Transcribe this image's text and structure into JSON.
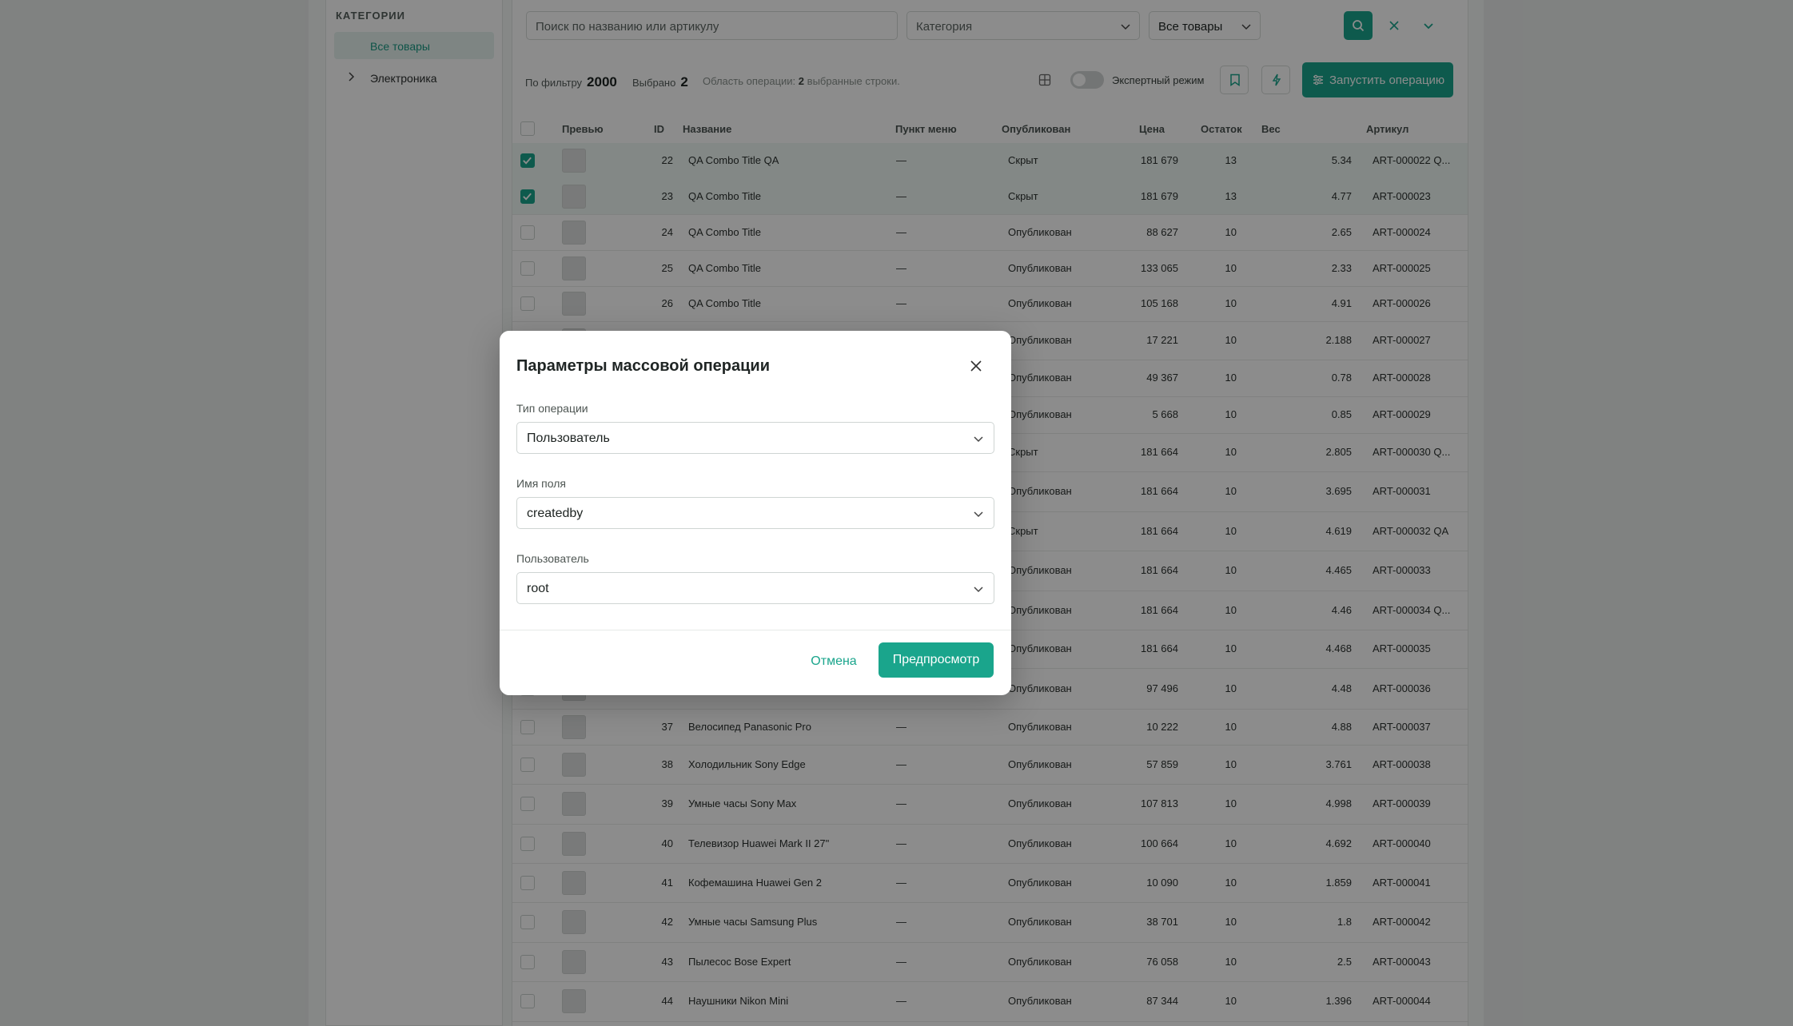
{
  "sidebar": {
    "title": "КАТЕГОРИИ",
    "items": [
      {
        "label": "Все товары"
      },
      {
        "label": "Электроника"
      }
    ]
  },
  "search": {
    "placeholder": "Поиск по названию или артикулу"
  },
  "filters": {
    "category": "Категория",
    "scope": "Все товары"
  },
  "stats": {
    "filter_label": "По фильтру",
    "filter_count": "2000",
    "selected_label": "Выбрано",
    "selected_count": "2",
    "scope_label": "Область операции:",
    "scope_count": "2",
    "scope_text": "выбранные строки."
  },
  "toolbar": {
    "expert_mode": "Экспертный режим",
    "run": "Запустить операцию"
  },
  "table": {
    "headers": {
      "preview": "Превью",
      "id": "ID",
      "name": "Название",
      "menu": "Пункт меню",
      "published": "Опубликован",
      "price": "Цена",
      "stock": "Остаток",
      "weight": "Вес",
      "sku": "Артикул"
    },
    "rows": [
      {
        "id": "22",
        "name": "QA Combo Title QA",
        "menu": "—",
        "status": "Скрыт",
        "price": "181 679",
        "stock": "13",
        "weight": "5.34",
        "sku": "ART-000022 Q...",
        "selected": true
      },
      {
        "id": "23",
        "name": "QA Combo Title",
        "menu": "—",
        "status": "Скрыт",
        "price": "181 679",
        "stock": "13",
        "weight": "4.77",
        "sku": "ART-000023",
        "selected": true
      },
      {
        "id": "24",
        "name": "QA Combo Title",
        "menu": "—",
        "status": "Опубликован",
        "price": "88 627",
        "stock": "10",
        "weight": "2.65",
        "sku": "ART-000024",
        "selected": false
      },
      {
        "id": "25",
        "name": "QA Combo Title",
        "menu": "—",
        "status": "Опубликован",
        "price": "133 065",
        "stock": "10",
        "weight": "2.33",
        "sku": "ART-000025",
        "selected": false
      },
      {
        "id": "26",
        "name": "QA Combo Title",
        "menu": "—",
        "status": "Опубликован",
        "price": "105 168",
        "stock": "10",
        "weight": "4.91",
        "sku": "ART-000026",
        "selected": false
      },
      {
        "id": "",
        "name": "",
        "menu": "",
        "status": "Опубликован",
        "price": "17 221",
        "stock": "10",
        "weight": "2.188",
        "sku": "ART-000027",
        "selected": false
      },
      {
        "id": "",
        "name": "",
        "menu": "",
        "status": "Опубликован",
        "price": "49 367",
        "stock": "10",
        "weight": "0.78",
        "sku": "ART-000028",
        "selected": false
      },
      {
        "id": "",
        "name": "",
        "menu": "",
        "status": "Опубликован",
        "price": "5 668",
        "stock": "10",
        "weight": "0.85",
        "sku": "ART-000029",
        "selected": false
      },
      {
        "id": "",
        "name": "",
        "menu": "",
        "status": "Скрыт",
        "price": "181 664",
        "stock": "10",
        "weight": "2.805",
        "sku": "ART-000030 Q...",
        "selected": false
      },
      {
        "id": "",
        "name": "",
        "menu": "",
        "status": "Опубликован",
        "price": "181 664",
        "stock": "10",
        "weight": "3.695",
        "sku": "ART-000031",
        "selected": false
      },
      {
        "id": "",
        "name": "",
        "menu": "",
        "status": "Скрыт",
        "price": "181 664",
        "stock": "10",
        "weight": "4.619",
        "sku": "ART-000032 QA",
        "selected": false
      },
      {
        "id": "",
        "name": "",
        "menu": "",
        "status": "Опубликован",
        "price": "181 664",
        "stock": "10",
        "weight": "4.465",
        "sku": "ART-000033",
        "selected": false
      },
      {
        "id": "",
        "name": "",
        "menu": "",
        "status": "Опубликован",
        "price": "181 664",
        "stock": "10",
        "weight": "4.46",
        "sku": "ART-000034 Q...",
        "selected": false
      },
      {
        "id": "",
        "name": "",
        "menu": "",
        "status": "Опубликован",
        "price": "181 664",
        "stock": "10",
        "weight": "4.468",
        "sku": "ART-000035",
        "selected": false
      },
      {
        "id": "",
        "name": "",
        "menu": "",
        "status": "Опубликован",
        "price": "97 496",
        "stock": "10",
        "weight": "4.48",
        "sku": "ART-000036",
        "selected": false
      },
      {
        "id": "37",
        "name": "Велосипед Panasonic Pro",
        "menu": "—",
        "status": "Опубликован",
        "price": "10 222",
        "stock": "10",
        "weight": "4.88",
        "sku": "ART-000037",
        "selected": false
      },
      {
        "id": "38",
        "name": "Холодильник Sony Edge",
        "menu": "—",
        "status": "Опубликован",
        "price": "57 859",
        "stock": "10",
        "weight": "3.761",
        "sku": "ART-000038",
        "selected": false
      },
      {
        "id": "39",
        "name": "Умные часы Sony Max",
        "menu": "—",
        "status": "Опубликован",
        "price": "107 813",
        "stock": "10",
        "weight": "4.998",
        "sku": "ART-000039",
        "selected": false
      },
      {
        "id": "40",
        "name": "Телевизор Huawei Mark II 27\"",
        "menu": "—",
        "status": "Опубликован",
        "price": "100 664",
        "stock": "10",
        "weight": "4.692",
        "sku": "ART-000040",
        "selected": false
      },
      {
        "id": "41",
        "name": "Кофемашина Huawei Gen 2",
        "menu": "—",
        "status": "Опубликован",
        "price": "10 090",
        "stock": "10",
        "weight": "1.859",
        "sku": "ART-000041",
        "selected": false
      },
      {
        "id": "42",
        "name": "Умные часы Samsung Plus",
        "menu": "—",
        "status": "Опубликован",
        "price": "38 701",
        "stock": "10",
        "weight": "1.8",
        "sku": "ART-000042",
        "selected": false
      },
      {
        "id": "43",
        "name": "Пылесос Bose Expert",
        "menu": "—",
        "status": "Опубликован",
        "price": "76 058",
        "stock": "10",
        "weight": "2.5",
        "sku": "ART-000043",
        "selected": false
      },
      {
        "id": "44",
        "name": "Наушники Nikon Mini",
        "menu": "—",
        "status": "Опубликован",
        "price": "87 344",
        "stock": "10",
        "weight": "1.396",
        "sku": "ART-000044",
        "selected": false
      }
    ]
  },
  "modal": {
    "title": "Параметры массовой операции",
    "fields": [
      {
        "label": "Тип операции",
        "value": "Пользователь"
      },
      {
        "label": "Имя поля",
        "value": "createdby"
      },
      {
        "label": "Пользователь",
        "value": "root"
      }
    ],
    "cancel": "Отмена",
    "preview": "Предпросмотр"
  },
  "colors": {
    "accent": "#1aa58c",
    "overlay": "rgba(0,0,0,0.45)"
  }
}
